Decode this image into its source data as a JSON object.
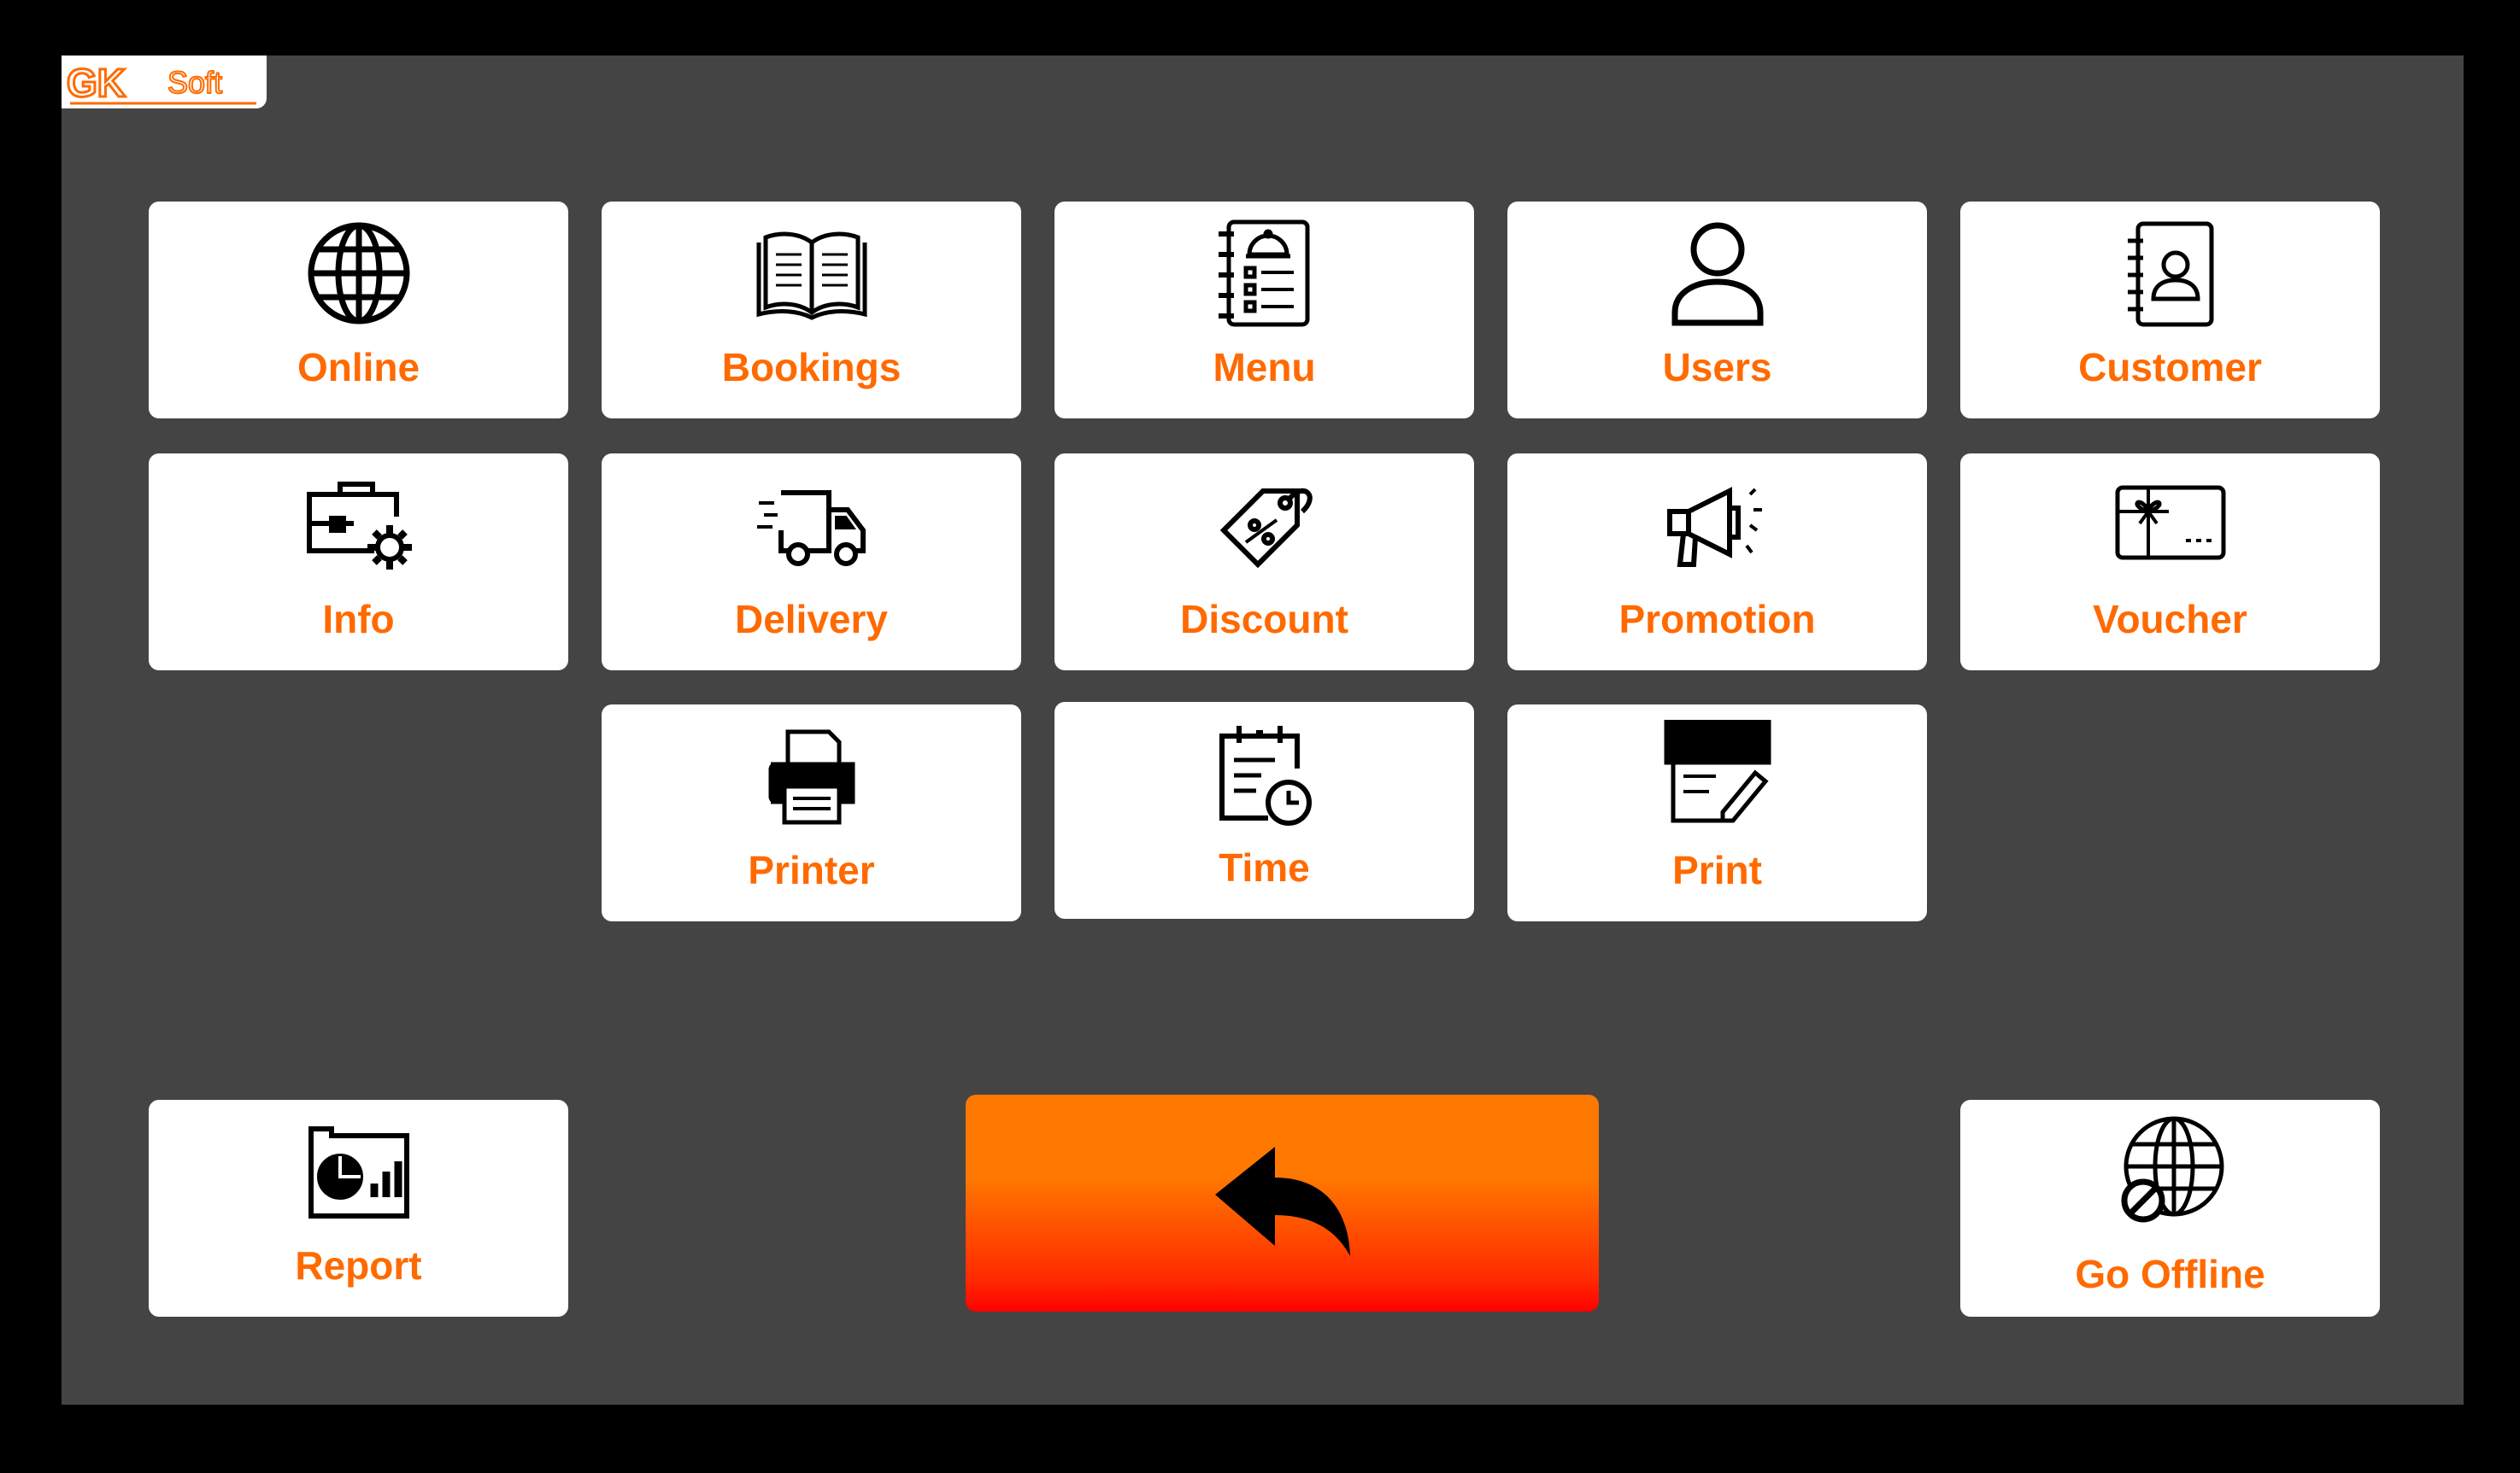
{
  "brand": {
    "logo_text_gk": "GK",
    "logo_text_soft": "Soft",
    "accent": "#ff6a00"
  },
  "tiles": {
    "online": {
      "label": "Online",
      "icon": "globe-icon"
    },
    "bookings": {
      "label": "Bookings",
      "icon": "book-icon"
    },
    "menu": {
      "label": "Menu",
      "icon": "menu-book-icon"
    },
    "users": {
      "label": "Users",
      "icon": "user-icon"
    },
    "customer": {
      "label": "Customer",
      "icon": "contact-book-icon"
    },
    "info": {
      "label": "Info",
      "icon": "briefcase-gear-icon"
    },
    "delivery": {
      "label": "Delivery",
      "icon": "delivery-truck-icon"
    },
    "discount": {
      "label": "Discount",
      "icon": "discount-tag-icon"
    },
    "promotion": {
      "label": "Promotion",
      "icon": "megaphone-icon"
    },
    "voucher": {
      "label": "Voucher",
      "icon": "gift-card-icon"
    },
    "printer": {
      "label": "Printer",
      "icon": "printer-icon"
    },
    "time": {
      "label": "Time",
      "icon": "calendar-clock-icon"
    },
    "print": {
      "label": "Print",
      "icon": "document-edit-icon"
    },
    "report": {
      "label": "Report",
      "icon": "report-chart-icon"
    },
    "go_offline": {
      "label": "Go Offline",
      "icon": "globe-offline-icon"
    }
  },
  "back": {
    "icon": "back-arrow-icon"
  }
}
